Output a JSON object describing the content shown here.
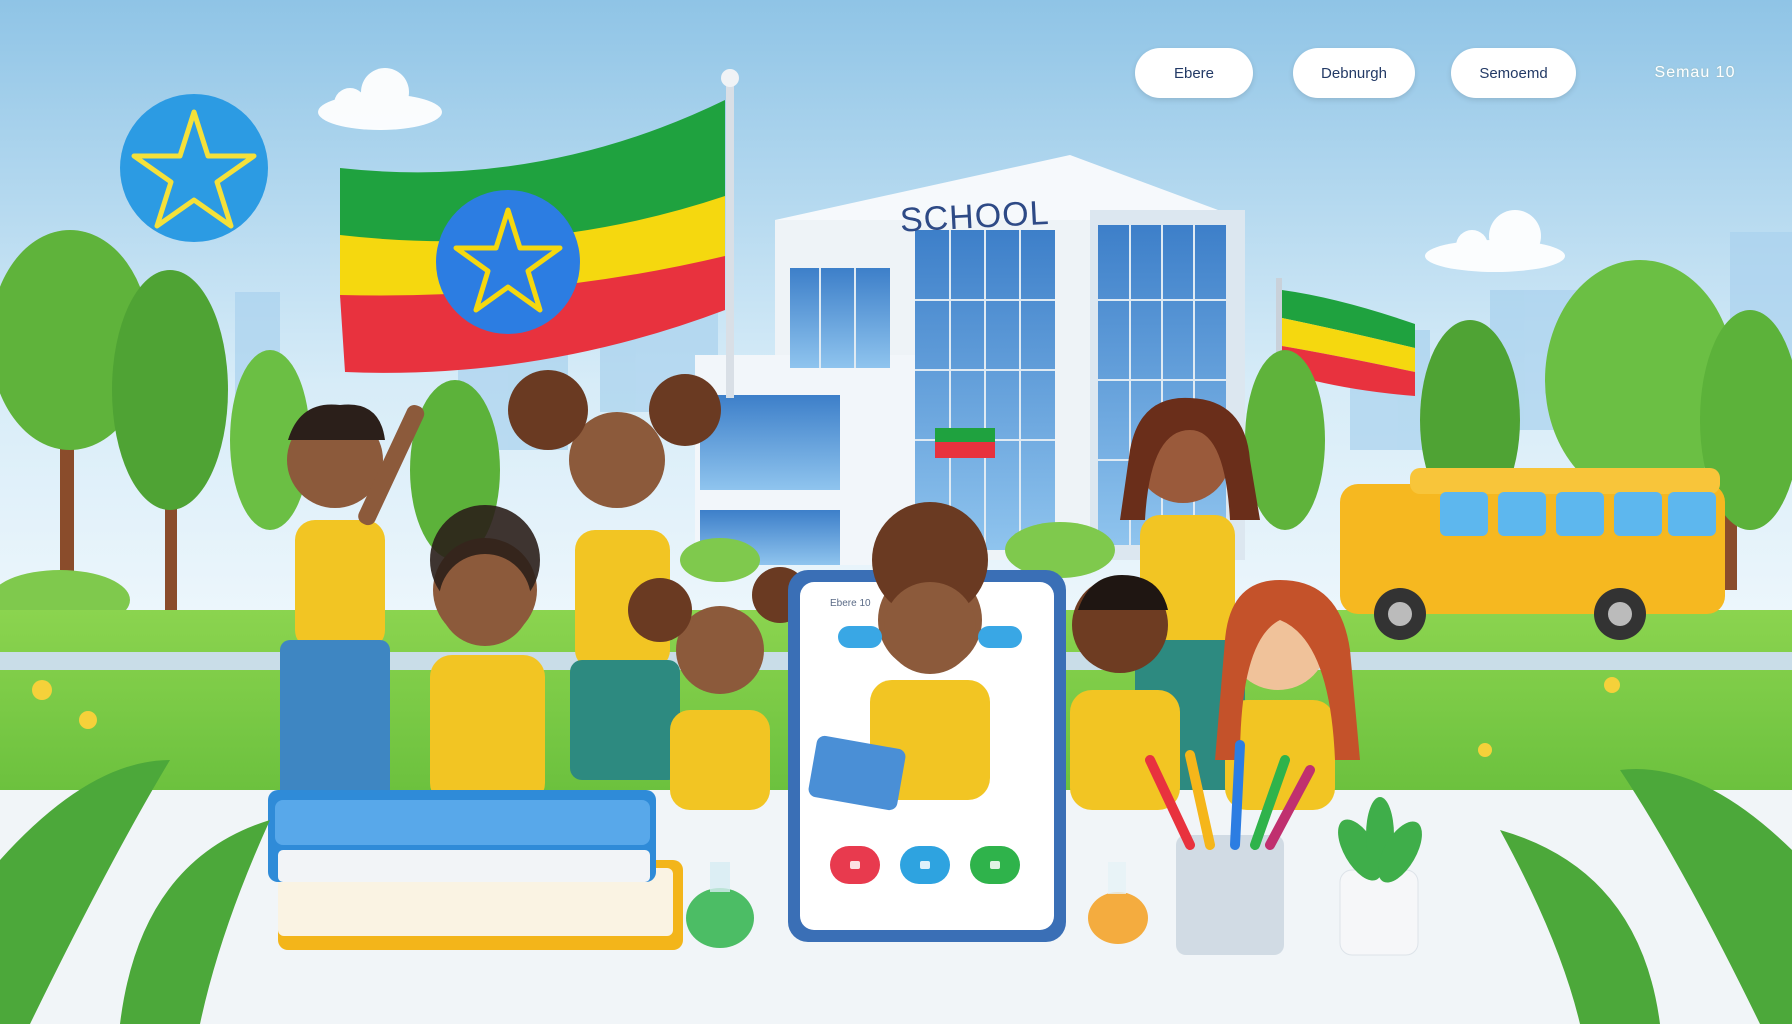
{
  "nav": {
    "items": [
      {
        "label": "Ebere"
      },
      {
        "label": "Debnurgh"
      },
      {
        "label": "Semoemd"
      }
    ],
    "extra_label": "Semau 10"
  },
  "scene": {
    "school_sign": "SCHOOL",
    "tablet_header": "Ebere 10"
  },
  "colors": {
    "sky_top": "#9ccbe8",
    "sky_bottom": "#e8f4fb",
    "grass": "#7dcc4a",
    "flag_green": "#1fa23f",
    "flag_yellow": "#f5d80f",
    "flag_red": "#e8323e",
    "emblem_blue": "#2c7de2",
    "bus_yellow": "#f6b820",
    "vest_yellow": "#f2c523"
  },
  "icons": {
    "emblem": "star-emblem-icon",
    "record": "record-icon",
    "chat": "chat-icon",
    "call": "call-icon"
  }
}
